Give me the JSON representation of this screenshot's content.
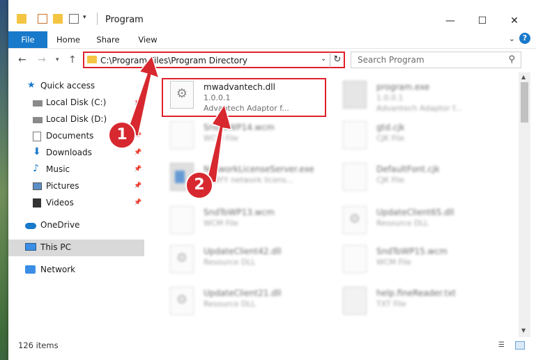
{
  "window": {
    "title": "Program",
    "quick_access_icons": [
      "folder-icon",
      "properties-icon",
      "new-folder-icon",
      "customize-icon"
    ],
    "minimize_label": "—",
    "maximize_label": "☐",
    "close_label": "✕"
  },
  "ribbon": {
    "tabs": [
      "File",
      "Home",
      "Share",
      "View"
    ],
    "help_label": "?"
  },
  "address": {
    "path": "C:\\Program Files\\Program Directory",
    "search_placeholder": "Search Program"
  },
  "sidebar": {
    "items": [
      {
        "label": "Quick access",
        "icon": "star-icon"
      },
      {
        "label": "Local Disk (C:)",
        "icon": "drive-icon"
      },
      {
        "label": "Local Disk (D:)",
        "icon": "drive-icon"
      },
      {
        "label": "Documents",
        "icon": "documents-icon"
      },
      {
        "label": "Downloads",
        "icon": "download-icon"
      },
      {
        "label": "Music",
        "icon": "music-icon"
      },
      {
        "label": "Pictures",
        "icon": "pictures-icon"
      },
      {
        "label": "Videos",
        "icon": "videos-icon"
      },
      {
        "label": "OneDrive",
        "icon": "cloud-icon"
      },
      {
        "label": "This PC",
        "icon": "computer-icon"
      },
      {
        "label": "Network",
        "icon": "network-icon"
      }
    ]
  },
  "files": [
    {
      "name": "mwadvantech.dll",
      "line2": "1.0.0.1",
      "line3": "Advantech Adaptor f...",
      "icon": "dll-gear-icon"
    },
    {
      "name": "program.exe",
      "line2": "1.0.0.1",
      "line3": "Advantech Adaptor f...",
      "icon": "exe-icon"
    },
    {
      "name": "SndToWP14.wcm",
      "line2": "WCM File",
      "line3": "",
      "icon": "document-icon"
    },
    {
      "name": "gtd.cjk",
      "line2": "CJK File",
      "line3": "",
      "icon": "document-icon"
    },
    {
      "name": "NetworkLicenseServer.exe",
      "line2": "ABBYY network licens...",
      "line3": "",
      "icon": "app-icon"
    },
    {
      "name": "DefaultFont.cjk",
      "line2": "CJK File",
      "line3": "",
      "icon": "document-icon"
    },
    {
      "name": "SndToWP13.wcm",
      "line2": "WCM File",
      "line3": "",
      "icon": "document-icon"
    },
    {
      "name": "UpdateClient65.dll",
      "line2": "Resource DLL",
      "line3": "",
      "icon": "dll-gear-icon"
    },
    {
      "name": "UpdateClient42.dll",
      "line2": "Resource DLL",
      "line3": "",
      "icon": "dll-gear-icon"
    },
    {
      "name": "SndToWP15.wcm",
      "line2": "WCM File",
      "line3": "",
      "icon": "document-icon"
    },
    {
      "name": "UpdateClient21.dll",
      "line2": "Resource DLL",
      "line3": "",
      "icon": "dll-gear-icon"
    },
    {
      "name": "help.fineReader.txt",
      "line2": "TXT File",
      "line3": "",
      "icon": "text-file-icon"
    }
  ],
  "status": {
    "item_count": "126 items"
  },
  "annotations": {
    "marker_1": "1",
    "marker_2": "2",
    "color": "#d7282f"
  }
}
